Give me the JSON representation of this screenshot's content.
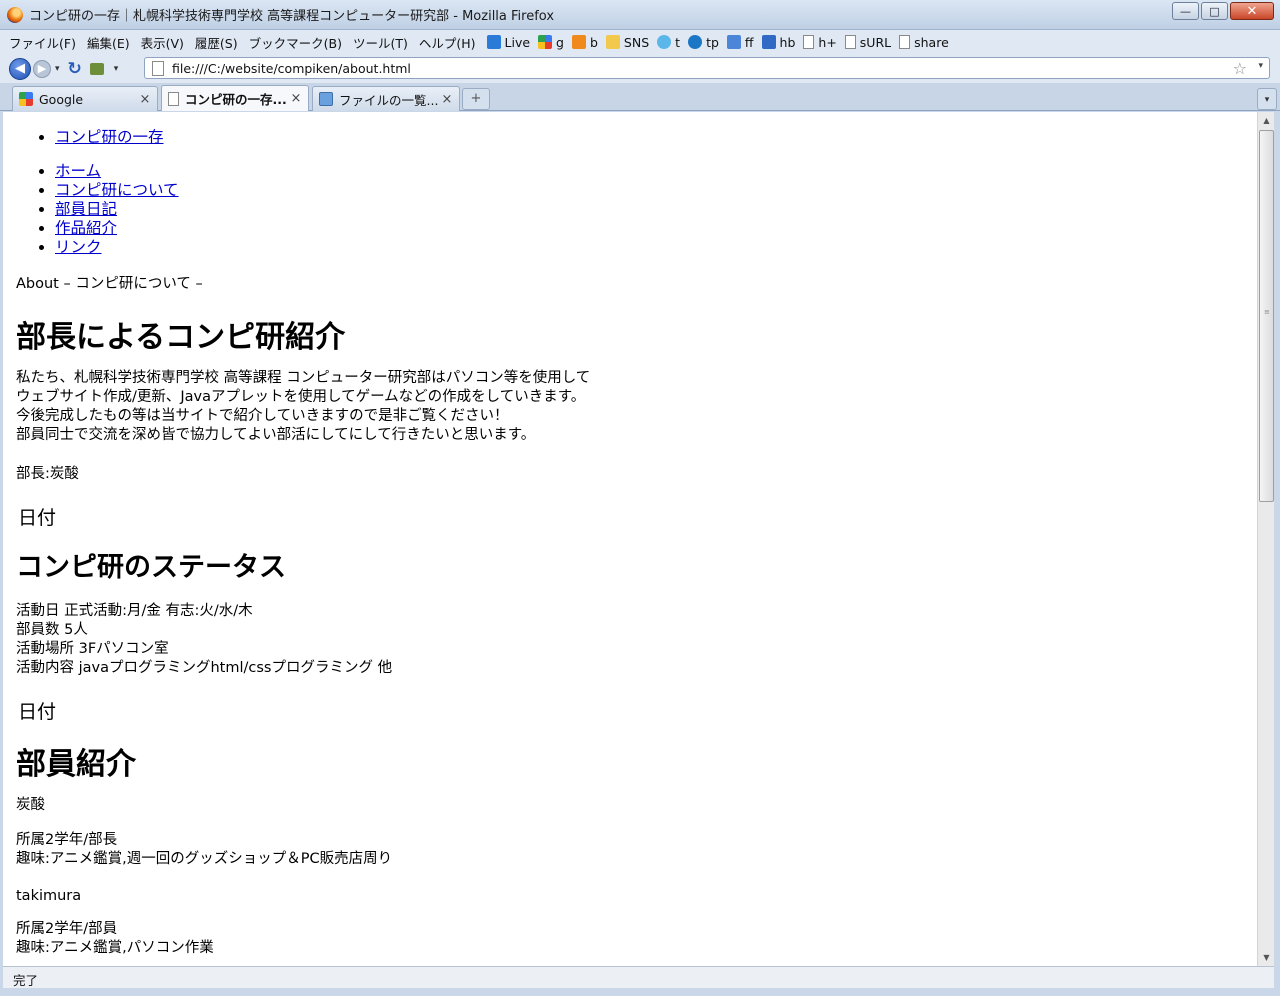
{
  "window": {
    "title": "コンピ研の一存｜札幌科学技術専門学校 高等課程コンピューター研究部 - Mozilla Firefox",
    "buttons": {
      "minimize": "—",
      "maximize": "□",
      "close": "✕"
    }
  },
  "menu": [
    "ファイル(F)",
    "編集(E)",
    "表示(V)",
    "履歴(S)",
    "ブックマーク(B)",
    "ツール(T)",
    "ヘルプ(H)"
  ],
  "bookmarks": [
    {
      "label": "Live",
      "icon": "windows-live-icon",
      "color": "#2a7ad8"
    },
    {
      "label": "g",
      "icon": "google-icon",
      "color": "#3a7af0"
    },
    {
      "label": "b",
      "icon": "blogger-icon",
      "color": "#f08a1c"
    },
    {
      "label": "SNS",
      "icon": "folder-icon",
      "color": "#f2c94c"
    },
    {
      "label": "t",
      "icon": "twitter-icon",
      "color": "#5bb6ea"
    },
    {
      "label": "tp",
      "icon": "tp-icon",
      "color": "#1c76c6"
    },
    {
      "label": "ff",
      "icon": "friendfeed-icon",
      "color": "#4c86d8"
    },
    {
      "label": "hb",
      "icon": "hatena-bookmark-icon",
      "color": "#3169c4"
    },
    {
      "label": "h+",
      "icon": "page-icon",
      "color": "#ffffff"
    },
    {
      "label": "sURL",
      "icon": "page-icon",
      "color": "#ffffff"
    },
    {
      "label": "share",
      "icon": "page-icon",
      "color": "#ffffff"
    }
  ],
  "nav": {
    "back_icon": "◀",
    "forward_icon": "▶",
    "dropdown_icon": "▾",
    "reload_icon": "↻",
    "url": "file:///C:/website/compiken/about.html",
    "star_icon": "☆"
  },
  "tabs": [
    {
      "label": "Google",
      "close": "×"
    },
    {
      "label": "コンピ研の一存...",
      "close": "×"
    },
    {
      "label": "ファイルの一覧...",
      "close": "×"
    }
  ],
  "new_tab_label": "+",
  "page": {
    "site_title_link": "コンピ研の一存",
    "nav_links": [
      "ホーム",
      "コンピ研について",
      "部員日記",
      "作品紹介",
      "リンク"
    ],
    "breadcrumb": "About – コンピ研について –",
    "heading_intro": "部長によるコンピ研紹介",
    "intro_lines": [
      "私たち、札幌科学技術専門学校 高等課程 コンピューター研究部はパソコン等を使用して",
      "ウェブサイト作成/更新、Javaアプレットを使用してゲームなどの作成をしていきます。",
      "今後完成したもの等は当サイトで紹介していきますので是非ご覧ください！",
      "部員同士で交流を深め皆で協力してよい部活にしてにして行きたいと思います。"
    ],
    "signature": "部長:炭酸",
    "date_label_1": "日付",
    "heading_status": "コンピ研のステータス",
    "status_lines": [
      "活動日 正式活動:月/金 有志:火/水/木",
      "部員数 5人",
      "活動場所 3Fパソコン室",
      "活動内容 javaプログラミングhtml/cssプログラミング 他"
    ],
    "date_label_2": "日付",
    "heading_members": "部員紹介",
    "members": [
      {
        "name": "炭酸",
        "lines": [
          "所属2学年/部長",
          "趣味:アニメ鑑賞,週一回のグッズショップ＆PC販売店周り"
        ]
      },
      {
        "name": "takimura",
        "lines": [
          "所属2学年/部員",
          "趣味:アニメ鑑賞,パソコン作業"
        ]
      }
    ]
  },
  "status": "完了"
}
